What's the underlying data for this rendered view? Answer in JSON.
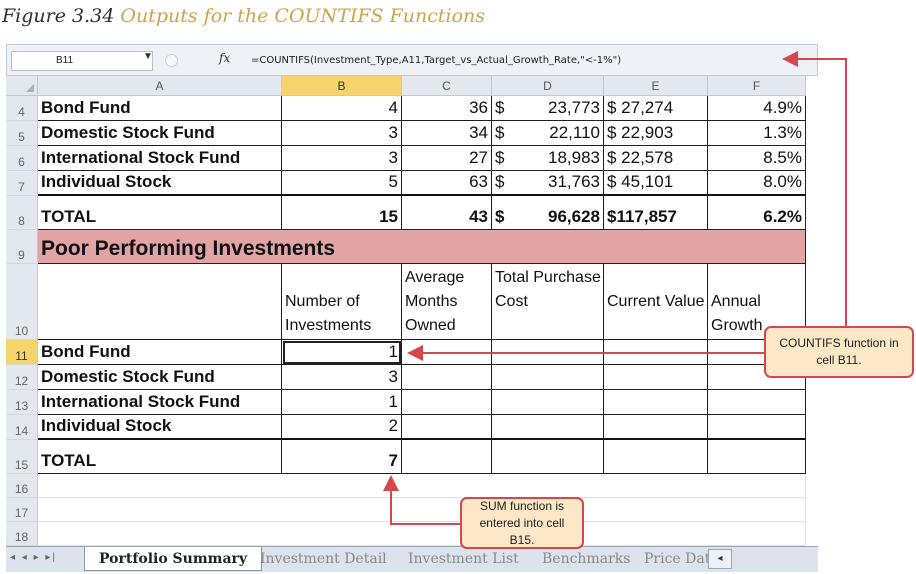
{
  "caption": {
    "label": "Figure 3.34",
    "title": "Outputs for the COUNTIFS Functions"
  },
  "formula_bar": {
    "name_box": "B11",
    "name_box_arrow": "▼",
    "fx_label": "fx",
    "formula": "=COUNTIFS(Investment_Type,A11,Target_vs_Actual_Growth_Rate,\"<-1%\")"
  },
  "columns": [
    "A",
    "B",
    "C",
    "D",
    "E",
    "F"
  ],
  "rows": {
    "r4": {
      "num": "4",
      "a": "Bond Fund",
      "b": "4",
      "c": "36",
      "d_cur": "$",
      "d": "23,773",
      "e": "$ 27,274",
      "f": "4.9%"
    },
    "r5": {
      "num": "5",
      "a": "Domestic Stock Fund",
      "b": "3",
      "c": "34",
      "d_cur": "$",
      "d": "22,110",
      "e": "$ 22,903",
      "f": "1.3%"
    },
    "r6": {
      "num": "6",
      "a": "International Stock Fund",
      "b": "3",
      "c": "27",
      "d_cur": "$",
      "d": "18,983",
      "e": "$ 22,578",
      "f": "8.5%"
    },
    "r7": {
      "num": "7",
      "a": "Individual Stock",
      "b": "5",
      "c": "63",
      "d_cur": "$",
      "d": "31,763",
      "e": "$ 45,101",
      "f": "8.0%"
    },
    "r8": {
      "num": "8",
      "a": "TOTAL",
      "b": "15",
      "c": "43",
      "d_cur": "$",
      "d": "96,628",
      "e": "$117,857",
      "f": "6.2%"
    },
    "r9": {
      "num": "9",
      "a": "Poor Performing Investments"
    },
    "r10": {
      "num": "10",
      "b": "Number of Investments",
      "c": "Average Months Owned",
      "d": "Total Purchase Cost",
      "e": "Current Value",
      "f": "Annual Growth"
    },
    "r11": {
      "num": "11",
      "a": "Bond Fund",
      "b": "1"
    },
    "r12": {
      "num": "12",
      "a": "Domestic Stock Fund",
      "b": "3"
    },
    "r13": {
      "num": "13",
      "a": "International Stock Fund",
      "b": "1"
    },
    "r14": {
      "num": "14",
      "a": "Individual Stock",
      "b": "2"
    },
    "r15": {
      "num": "15",
      "a": "TOTAL",
      "b": "7"
    },
    "r16": {
      "num": "16"
    },
    "r17": {
      "num": "17"
    },
    "r18": {
      "num": "18"
    }
  },
  "tabs": {
    "nav": "◂ ◂ ▸ ▸|",
    "items": [
      "Portfolio Summary",
      "Investment Detail",
      "Investment List",
      "Benchmarks",
      "Price Dat"
    ],
    "active": "Portfolio Summary",
    "scroll": "◂"
  },
  "callouts": {
    "countifs": "COUNTIFS function in cell B11.",
    "sum": "SUM function is entered into cell B15."
  },
  "colors": {
    "accent_red": "#d4474d",
    "callout_fill": "#fce7c6",
    "banner": "#e2a4a4",
    "selected_header": "#f6d36b",
    "caption_title": "#d0a24a"
  }
}
